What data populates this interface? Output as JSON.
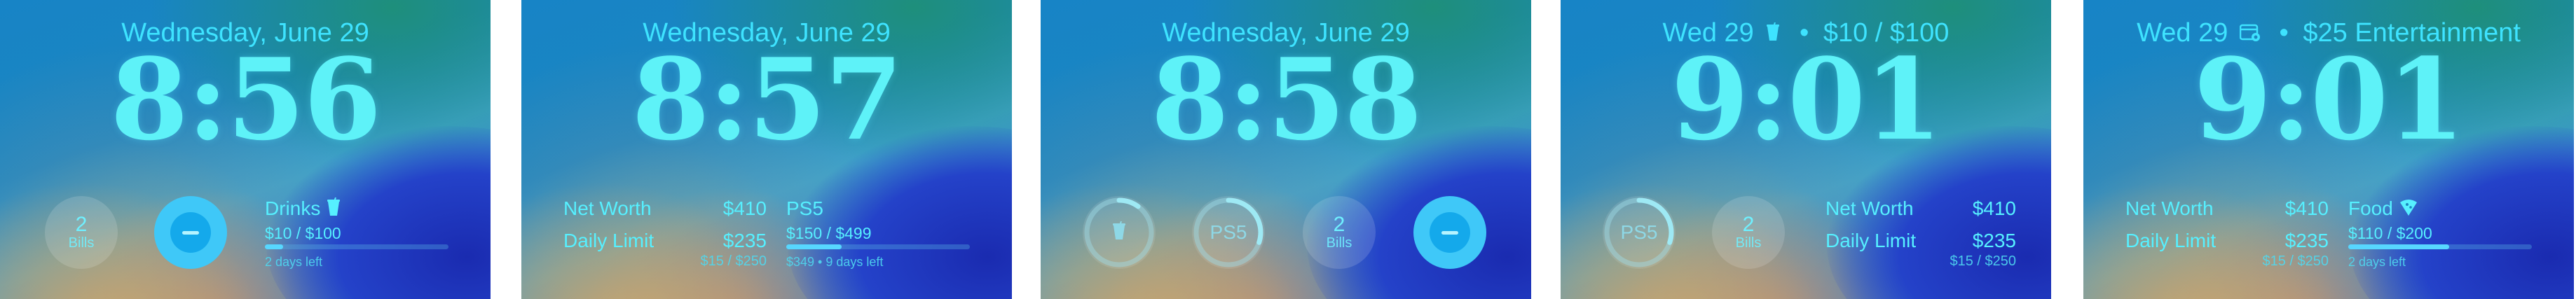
{
  "colors": {
    "accent": "#56f0ff",
    "time": "#5ef2f8",
    "bar_fill": "#57d7ff"
  },
  "screens": [
    {
      "date": "Wednesday, June 29",
      "time": "8:56",
      "bills": {
        "count": "2",
        "label": "Bills"
      },
      "widget": {
        "title": "Drinks",
        "icon": "cup-icon",
        "amount": "$10 / $100",
        "progress": 0.1,
        "remaining": "2 days left"
      }
    },
    {
      "date": "Wednesday, June 29",
      "time": "8:57",
      "net_worth": {
        "label": "Net Worth",
        "value": "$410"
      },
      "daily_limit": {
        "label": "Daily Limit",
        "value": "$235",
        "sub": "$15 / $250"
      },
      "goal": {
        "title": "PS5",
        "amount": "$150 / $499",
        "progress": 0.3,
        "detail": "$349 • 9 days left"
      }
    },
    {
      "date": "Wednesday, June 29",
      "time": "8:58",
      "drinks_ring": {
        "icon": "cup-icon",
        "progress": 0.1
      },
      "ps5_ring": {
        "label": "PS5",
        "progress": 0.3
      },
      "bills": {
        "count": "2",
        "label": "Bills"
      }
    },
    {
      "date_short": "Wed 29",
      "date_icon": "cup-icon",
      "date_budget": "$10 / $100",
      "time": "9:01",
      "ps5_ring": {
        "label": "PS5",
        "progress": 0.3
      },
      "bills": {
        "count": "2",
        "label": "Bills"
      },
      "net_worth": {
        "label": "Net Worth",
        "value": "$410"
      },
      "daily_limit": {
        "label": "Daily Limit",
        "value": "$235",
        "sub": "$15 / $250"
      }
    },
    {
      "date_short": "Wed 29",
      "date_icon": "calendar-icon",
      "date_budget": "$25 Entertainment",
      "time": "9:01",
      "net_worth": {
        "label": "Net Worth",
        "value": "$410"
      },
      "daily_limit": {
        "label": "Daily Limit",
        "value": "$235",
        "sub": "$15 / $250"
      },
      "widget": {
        "title": "Food",
        "icon": "pizza-icon",
        "amount": "$110 / $200",
        "progress": 0.55,
        "remaining": "2 days left"
      }
    }
  ]
}
